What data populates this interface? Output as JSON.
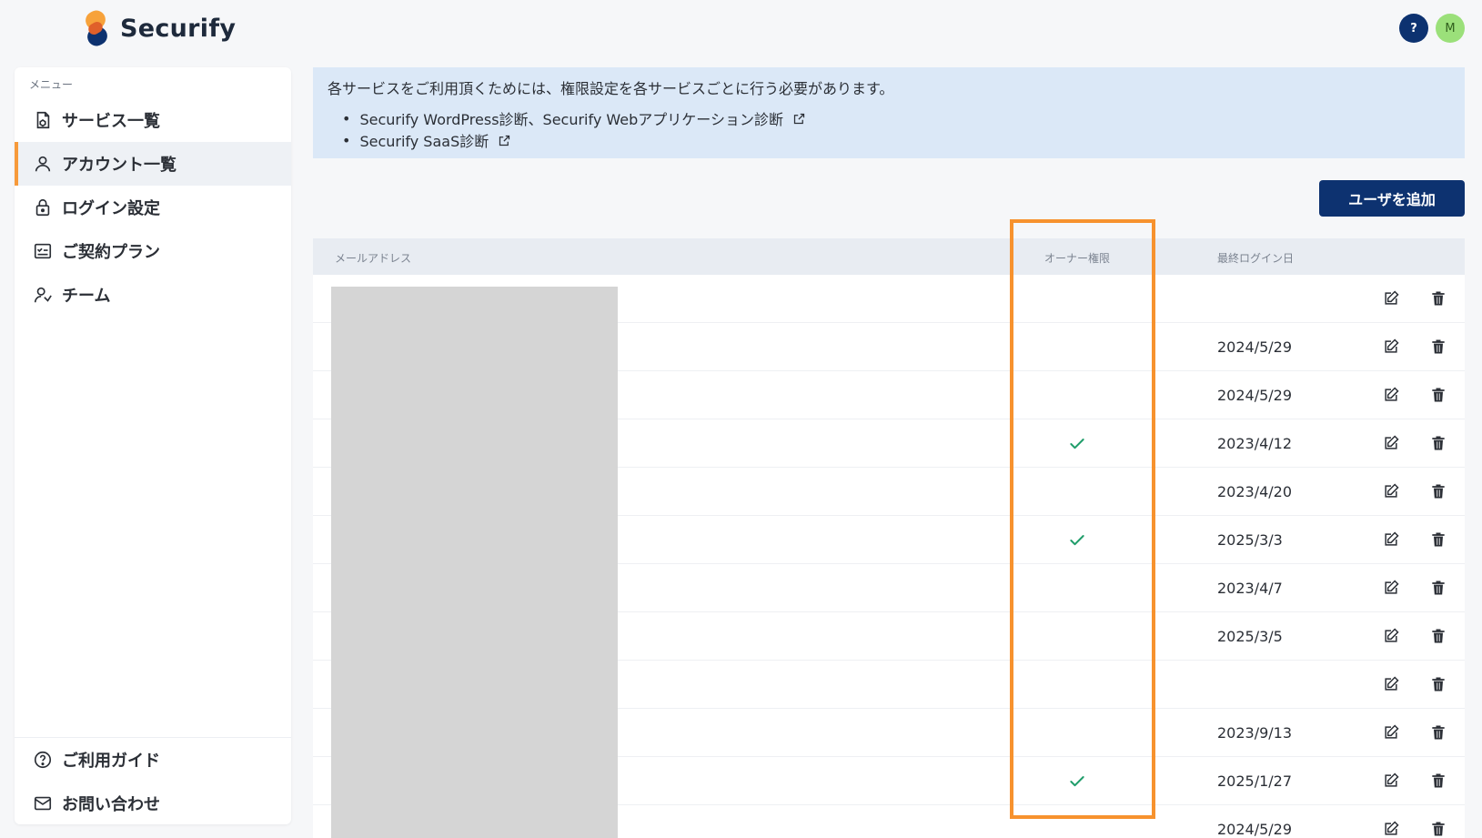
{
  "brand": {
    "name": "Securify"
  },
  "header": {
    "help_label": "?",
    "avatar_initial": "M"
  },
  "sidebar": {
    "caption": "メニュー",
    "items": [
      {
        "label": "サービス一覧",
        "icon": "service-box-icon"
      },
      {
        "label": "アカウント一覧",
        "icon": "user-icon",
        "active": true
      },
      {
        "label": "ログイン設定",
        "icon": "lock-icon"
      },
      {
        "label": "ご契約プラン",
        "icon": "checklist-icon"
      },
      {
        "label": "チーム",
        "icon": "team-icon"
      }
    ],
    "bottom": [
      {
        "label": "ご利用ガイド",
        "icon": "question-circle-icon"
      },
      {
        "label": "お問い合わせ",
        "icon": "mail-icon"
      }
    ]
  },
  "info": {
    "text": "各サービスをご利用頂くためには、権限設定を各サービスごとに行う必要があります。",
    "links": [
      "Securify WordPress診断、Securify Webアプリケーション診断",
      "Securify SaaS診断"
    ]
  },
  "actions": {
    "add_user": "ユーザを追加"
  },
  "table": {
    "columns": {
      "email": "メールアドレス",
      "owner": "オーナー権限",
      "last_login": "最終ログイン日"
    },
    "rows": [
      {
        "owner": false,
        "last_login": ""
      },
      {
        "owner": false,
        "last_login": "2024/5/29"
      },
      {
        "owner": false,
        "last_login": "2024/5/29"
      },
      {
        "owner": true,
        "last_login": "2023/4/12"
      },
      {
        "owner": false,
        "last_login": "2023/4/20"
      },
      {
        "owner": true,
        "last_login": "2025/3/3"
      },
      {
        "owner": false,
        "last_login": "2023/4/7"
      },
      {
        "owner": false,
        "last_login": "2025/3/5"
      },
      {
        "owner": false,
        "last_login": ""
      },
      {
        "owner": false,
        "last_login": "2023/9/13"
      },
      {
        "owner": true,
        "last_login": "2025/1/27"
      },
      {
        "owner": false,
        "last_login": "2024/5/29"
      }
    ]
  },
  "colors": {
    "primary": "#0d3270",
    "accent": "#f79a3b",
    "highlight": "#f7922e",
    "check": "#1f9d6a",
    "info_bg": "#dbe8f7"
  }
}
